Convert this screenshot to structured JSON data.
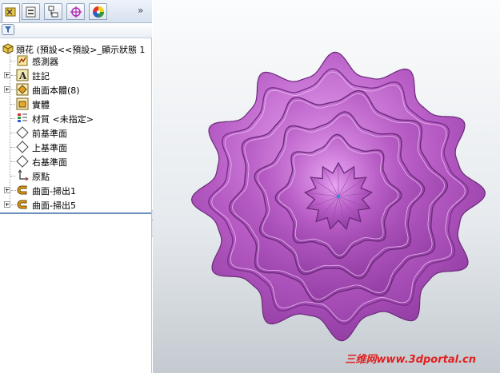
{
  "tree": {
    "root_label": "頭花 (預設<<預設>_顯示狀態 1",
    "items": [
      {
        "label": "感測器"
      },
      {
        "label": "註記"
      },
      {
        "label": "曲面本體(8)"
      },
      {
        "label": "實體"
      },
      {
        "label": "材質 <未指定>"
      },
      {
        "label": "前基準面"
      },
      {
        "label": "上基準面"
      },
      {
        "label": "右基準面"
      },
      {
        "label": "原點"
      },
      {
        "label": "曲面-掃出1"
      },
      {
        "label": "曲面-掃出5"
      }
    ]
  },
  "toolbar": {
    "more_label": "»"
  },
  "viewport": {
    "watermark": "三维网www.3dportal.cn"
  },
  "colors": {
    "model": "#b65bc4",
    "accent": "#3a6db5"
  }
}
